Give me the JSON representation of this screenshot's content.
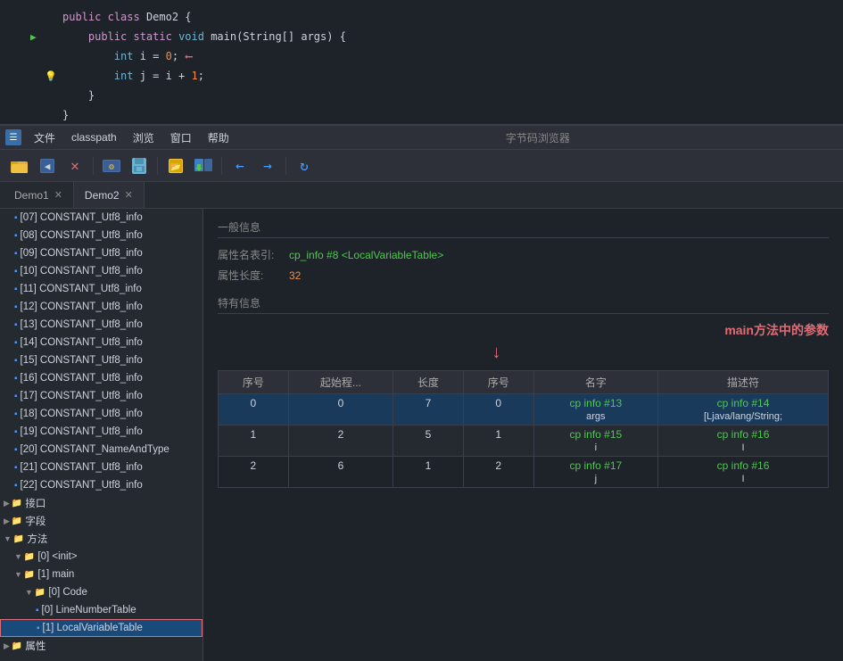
{
  "editor": {
    "lines": [
      {
        "num": "",
        "gutter_extra": "",
        "has_run": false,
        "has_bulb": false,
        "content": "public class Demo2 {",
        "tokens": [
          {
            "text": "public ",
            "cls": "kw"
          },
          {
            "text": "class ",
            "cls": "kw-blue"
          },
          {
            "text": "Demo2 {",
            "cls": ""
          }
        ]
      },
      {
        "num": "",
        "gutter_extra": "▶",
        "has_run": true,
        "has_bulb": false,
        "content": "    public static void main(String[] args) {",
        "tokens": [
          {
            "text": "    "
          },
          {
            "text": "public ",
            "cls": "kw"
          },
          {
            "text": "static ",
            "cls": "kw"
          },
          {
            "text": "void ",
            "cls": "kw-blue"
          },
          {
            "text": "main(String[] args) {",
            "cls": ""
          }
        ]
      },
      {
        "num": "",
        "gutter_extra": "",
        "has_run": false,
        "has_bulb": false,
        "content": "        int i = 0;",
        "arrow": true,
        "tokens": [
          {
            "text": "        "
          },
          {
            "text": "int ",
            "cls": "kw-blue"
          },
          {
            "text": "i = "
          },
          {
            "text": "0",
            "cls": "num"
          },
          {
            "text": ";"
          }
        ]
      },
      {
        "num": "",
        "gutter_extra": "",
        "has_run": false,
        "has_bulb": true,
        "content": "        int j = i + 1;",
        "tokens": [
          {
            "text": "        "
          },
          {
            "text": "int ",
            "cls": "kw-blue"
          },
          {
            "text": "j = i + "
          },
          {
            "text": "1",
            "cls": "num"
          },
          {
            "text": ";"
          }
        ]
      },
      {
        "num": "",
        "gutter_extra": "",
        "has_run": false,
        "has_bulb": false,
        "content": "    }",
        "tokens": [
          {
            "text": "    }"
          }
        ]
      },
      {
        "num": "",
        "gutter_extra": "",
        "has_run": false,
        "has_bulb": false,
        "content": "}",
        "tokens": [
          {
            "text": "}"
          }
        ]
      }
    ]
  },
  "menubar": {
    "title": "字节码浏览器",
    "items": [
      "文件",
      "classpath",
      "浏览",
      "窗口",
      "帮助"
    ]
  },
  "toolbar": {
    "buttons": [
      {
        "id": "open-folder",
        "icon": "📁",
        "tooltip": "Open"
      },
      {
        "id": "back",
        "icon": "◀",
        "tooltip": "Back"
      },
      {
        "id": "close",
        "icon": "✕",
        "tooltip": "Close"
      },
      {
        "id": "compile1",
        "icon": "⚙",
        "tooltip": "Compile"
      },
      {
        "id": "compile2",
        "icon": "💾",
        "tooltip": "Save"
      },
      {
        "id": "import1",
        "icon": "📂",
        "tooltip": "Import"
      },
      {
        "id": "import2",
        "icon": "📤",
        "tooltip": "Export"
      },
      {
        "id": "nav-back",
        "icon": "←",
        "tooltip": "Navigate Back"
      },
      {
        "id": "nav-forward",
        "icon": "→",
        "tooltip": "Navigate Forward"
      },
      {
        "id": "refresh",
        "icon": "↻",
        "tooltip": "Refresh"
      }
    ]
  },
  "tabs": [
    {
      "id": "demo1",
      "label": "Demo1",
      "active": false
    },
    {
      "id": "demo2",
      "label": "Demo2",
      "active": true
    }
  ],
  "sidebar": {
    "items": [
      {
        "id": "s07",
        "indent": 0,
        "icon": "📄",
        "label": "[07] CONSTANT_Utf8_info",
        "arrow": false
      },
      {
        "id": "s08",
        "indent": 0,
        "icon": "📄",
        "label": "[08] CONSTANT_Utf8_info",
        "arrow": false
      },
      {
        "id": "s09",
        "indent": 0,
        "icon": "📄",
        "label": "[09] CONSTANT_Utf8_info",
        "arrow": false
      },
      {
        "id": "s10",
        "indent": 0,
        "icon": "📄",
        "label": "[10] CONSTANT_Utf8_info",
        "arrow": false
      },
      {
        "id": "s11",
        "indent": 0,
        "icon": "📄",
        "label": "[11] CONSTANT_Utf8_info",
        "arrow": false
      },
      {
        "id": "s12",
        "indent": 0,
        "icon": "📄",
        "label": "[12] CONSTANT_Utf8_info",
        "arrow": false
      },
      {
        "id": "s13",
        "indent": 0,
        "icon": "📄",
        "label": "[13] CONSTANT_Utf8_info",
        "arrow": false
      },
      {
        "id": "s14",
        "indent": 0,
        "icon": "📄",
        "label": "[14] CONSTANT_Utf8_info",
        "arrow": false
      },
      {
        "id": "s15",
        "indent": 0,
        "icon": "📄",
        "label": "[15] CONSTANT_Utf8_info",
        "arrow": false
      },
      {
        "id": "s16",
        "indent": 0,
        "icon": "📄",
        "label": "[16] CONSTANT_Utf8_info",
        "arrow": false
      },
      {
        "id": "s17",
        "indent": 0,
        "icon": "📄",
        "label": "[17] CONSTANT_Utf8_info",
        "arrow": false
      },
      {
        "id": "s18",
        "indent": 0,
        "icon": "📄",
        "label": "[18] CONSTANT_Utf8_info",
        "arrow": false
      },
      {
        "id": "s19",
        "indent": 0,
        "icon": "📄",
        "label": "[19] CONSTANT_Utf8_info",
        "arrow": false
      },
      {
        "id": "s20",
        "indent": 0,
        "icon": "📄",
        "label": "[20] CONSTANT_NameAndType",
        "arrow": false
      },
      {
        "id": "s21",
        "indent": 0,
        "icon": "📄",
        "label": "[21] CONSTANT_Utf8_info",
        "arrow": false
      },
      {
        "id": "s22",
        "indent": 0,
        "icon": "📄",
        "label": "[22] CONSTANT_Utf8_info",
        "arrow": false
      },
      {
        "id": "interface",
        "indent": 0,
        "icon": "",
        "label": "接口",
        "arrow": false,
        "group": true
      },
      {
        "id": "field",
        "indent": 0,
        "icon": "",
        "label": "字段",
        "arrow": false,
        "group": true
      },
      {
        "id": "method",
        "indent": 0,
        "icon": "",
        "label": "方法",
        "arrow": false,
        "group": true,
        "expanded": true
      },
      {
        "id": "init",
        "indent": 1,
        "icon": "📁",
        "label": "[0] <init>",
        "arrow": "▼",
        "expanded": true
      },
      {
        "id": "main",
        "indent": 1,
        "icon": "📁",
        "label": "[1] main",
        "arrow": "▼",
        "expanded": true
      },
      {
        "id": "code",
        "indent": 2,
        "icon": "📁",
        "label": "[0] Code",
        "arrow": "▼",
        "expanded": true
      },
      {
        "id": "linenumber",
        "indent": 3,
        "icon": "📄",
        "label": "[0] LineNumberTable",
        "arrow": false
      },
      {
        "id": "localvariable",
        "indent": 3,
        "icon": "📄",
        "label": "[1] LocalVariableTable",
        "arrow": false,
        "selected": true
      },
      {
        "id": "property",
        "indent": 0,
        "icon": "",
        "label": "属性",
        "arrow": false,
        "group": true
      }
    ]
  },
  "right_panel": {
    "general_info_title": "一般信息",
    "attr_name_label": "属性名表引:",
    "attr_name_value": "cp_info #8  <LocalVariableTable>",
    "attr_len_label": "属性长度:",
    "attr_len_value": "32",
    "special_info_title": "特有信息",
    "annotation": "main方法中的参数",
    "table": {
      "columns": [
        "序号",
        "起始程...",
        "长度",
        "序号",
        "名字",
        "描述符"
      ],
      "rows": [
        {
          "seq": "0",
          "start": "0",
          "len": "7",
          "idx": "0",
          "name_link": "cp info #13",
          "name_sub": "args",
          "desc_link": "cp info #14",
          "desc_sub": "[Ljava/lang/String;",
          "selected": true
        },
        {
          "seq": "1",
          "start": "2",
          "len": "5",
          "idx": "1",
          "name_link": "cp info #15",
          "name_sub": "i",
          "desc_link": "cp info #16",
          "desc_sub": "I",
          "selected": false
        },
        {
          "seq": "2",
          "start": "6",
          "len": "1",
          "idx": "2",
          "name_link": "cp info #17",
          "name_sub": "j",
          "desc_link": "cp info #16",
          "desc_sub": "I",
          "selected": false
        }
      ]
    }
  }
}
